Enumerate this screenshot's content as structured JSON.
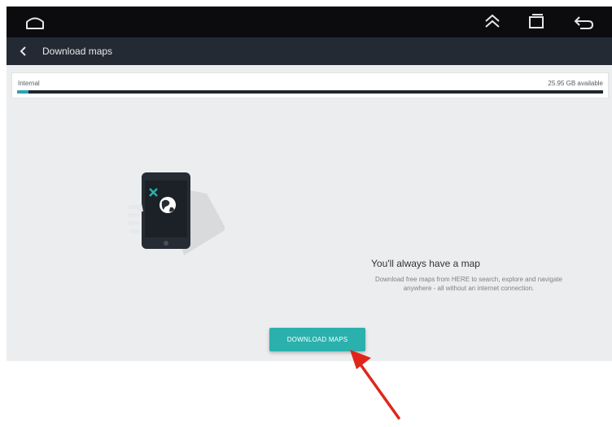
{
  "status_bar": {
    "icons": [
      "home-icon",
      "expand-up-icon",
      "recent-apps-icon",
      "back-icon"
    ],
    "background": "#0c0c0f"
  },
  "toolbar": {
    "title": "Download maps",
    "back_icon": "chevron-left-icon",
    "background": "#242a33"
  },
  "storage": {
    "label": "Internal",
    "available": "25.95 GB available",
    "used_fraction": 0.02,
    "bar_color": "#2f9fb3"
  },
  "promo": {
    "title": "You'll always have a map",
    "description_line1": "Download free maps from HERE to search, explore and navigate",
    "description_line2": "anywhere - all without an internet connection.",
    "illustration": "phone-with-globe-icon"
  },
  "download_button": {
    "label": "DOWNLOAD MAPS",
    "color": "#2bb1ad"
  },
  "annotation": {
    "icon": "red-arrow-icon",
    "color": "#e0261b"
  }
}
